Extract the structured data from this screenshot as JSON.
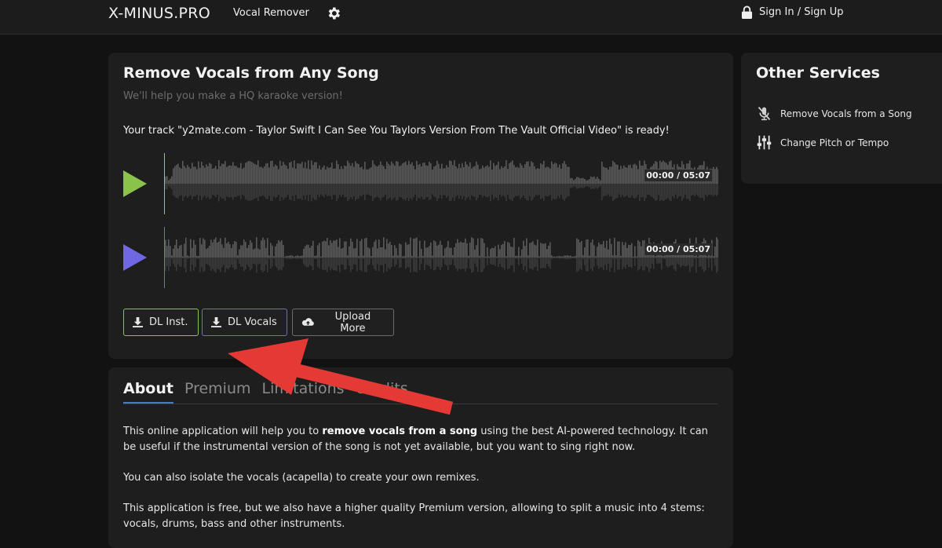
{
  "header": {
    "brand": "X-MINUS.PRO",
    "nav_link": "Vocal Remover",
    "settings_icon": "gear-icon",
    "signin_icon": "lock-icon",
    "signin_label": "Sign In / Sign Up"
  },
  "main": {
    "title": "Remove Vocals from Any Song",
    "subtitle": "We'll help you make a HQ karaoke version!",
    "status": "Your track \"y2mate.com - Taylor Swift I Can See You Taylors Version From The Vault Official Video\" is ready!",
    "tracks": [
      {
        "name": "instrumental",
        "time": "00:00 / 05:07",
        "color": "#8bc34a",
        "icon": "play-icon"
      },
      {
        "name": "vocals",
        "time": "00:00 / 05:07",
        "color": "#6f67e3",
        "icon": "play-icon"
      }
    ],
    "buttons": {
      "dl_inst": "DL Inst.",
      "dl_vocals": "DL Vocals",
      "upload_more": "Upload More"
    }
  },
  "side": {
    "title": "Other Services",
    "items": [
      {
        "label": "Remove Vocals from a Song",
        "icon": "mic-off-icon"
      },
      {
        "label": "Change Pitch or Tempo",
        "icon": "sliders-icon"
      }
    ]
  },
  "about": {
    "tabs": [
      "About",
      "Premium",
      "Limitations",
      "Credits"
    ],
    "active_tab": "About",
    "p1_a": "This online application will help you to ",
    "p1_b": "remove vocals from a song",
    "p1_c": " using the best AI-powered technology. It can be useful if the instrumental version of the song is not yet available, but you want to sing right now.",
    "p2": "You can also isolate the vocals (acapella) to create your own remixes.",
    "p3": "This application is free, but we also have a higher quality Premium version, allowing to split a music into 4 stems: vocals, drums, bass and other instruments."
  },
  "colors": {
    "accent_inst": "#8bc34a",
    "accent_vocals": "#6f67e3",
    "annotation_arrow": "#e53935"
  }
}
